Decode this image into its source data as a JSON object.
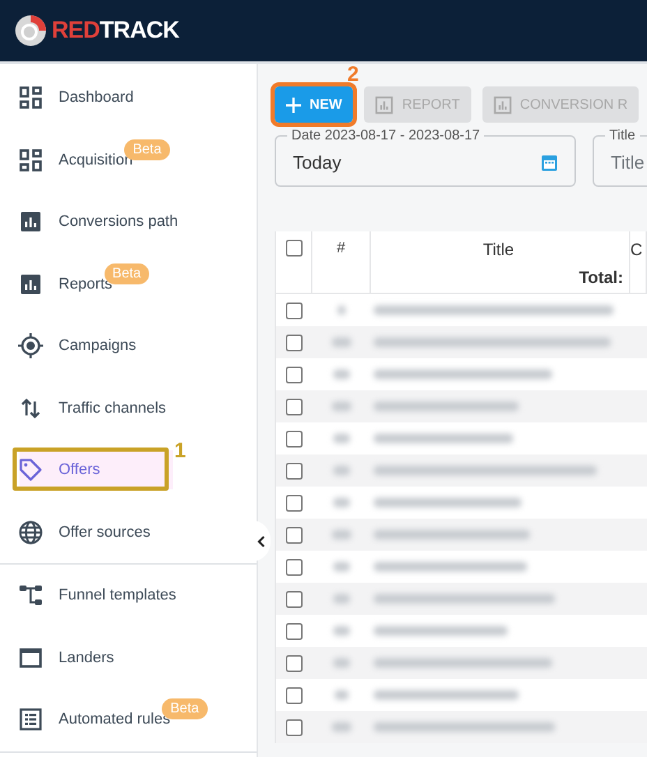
{
  "header": {
    "logo_part_1": "RED",
    "logo_part_2": "TRACK"
  },
  "sidebar": {
    "items": [
      {
        "label": "Dashboard",
        "selected": false
      },
      {
        "label": "Acquisition",
        "selected": false,
        "badge": "Beta"
      },
      {
        "label": "Conversions path",
        "selected": false
      },
      {
        "label": "Reports",
        "selected": false,
        "badge": "Beta"
      },
      {
        "label": "Campaigns",
        "selected": false
      },
      {
        "label": "Traffic channels",
        "selected": false
      },
      {
        "label": "Offers",
        "selected": true,
        "annotation": "1"
      },
      {
        "label": "Offer sources",
        "selected": false,
        "divider_after": true
      },
      {
        "label": "Funnel templates",
        "selected": false
      },
      {
        "label": "Landers",
        "selected": false
      },
      {
        "label": "Automated rules",
        "selected": false,
        "badge": "Beta",
        "divider_after": true
      }
    ]
  },
  "toolbar": {
    "buttons": [
      {
        "label": "NEW",
        "kind": "primary",
        "annotation": "2"
      },
      {
        "label": "REPORT",
        "kind": "disabled"
      },
      {
        "label": "CONVERSION R",
        "kind": "disabled"
      }
    ]
  },
  "filters": [
    {
      "label": "Date 2023-08-17 - 2023-08-17",
      "value": "Today",
      "kind": "date"
    },
    {
      "label": "Title",
      "placeholder": "Title",
      "kind": "text"
    }
  ],
  "table": {
    "columns": [
      "#",
      "Title",
      "C"
    ],
    "total_label": "Total:",
    "header_checked": false,
    "rows": [
      {
        "checked": false
      },
      {
        "checked": false
      },
      {
        "checked": false
      },
      {
        "checked": false
      },
      {
        "checked": false
      },
      {
        "checked": false
      },
      {
        "checked": false
      },
      {
        "checked": false
      },
      {
        "checked": false
      },
      {
        "checked": false
      },
      {
        "checked": false
      },
      {
        "checked": false
      },
      {
        "checked": false
      },
      {
        "checked": false
      }
    ]
  }
}
